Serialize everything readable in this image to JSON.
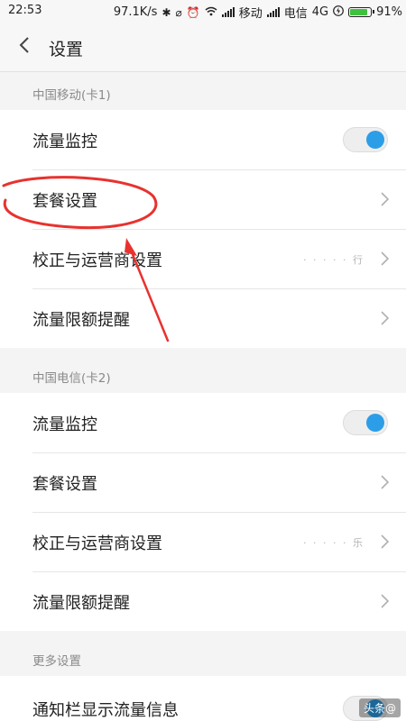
{
  "status_bar": {
    "time": "22:53",
    "net_speed": "97.1K/s",
    "carrier1": "移动",
    "carrier2": "电信",
    "network_type": "4G",
    "battery_pct": "91%",
    "battery_level": 0.91
  },
  "header": {
    "title": "设置"
  },
  "sections": [
    {
      "label": "中国移动(卡1)",
      "rows": [
        {
          "label": "流量监控",
          "type": "toggle",
          "on": true
        },
        {
          "label": "套餐设置",
          "type": "nav"
        },
        {
          "label": "校正与运营商设置",
          "type": "nav",
          "value": "· · · · · 行"
        },
        {
          "label": "流量限额提醒",
          "type": "nav"
        }
      ]
    },
    {
      "label": "中国电信(卡2)",
      "rows": [
        {
          "label": "流量监控",
          "type": "toggle",
          "on": true
        },
        {
          "label": "套餐设置",
          "type": "nav"
        },
        {
          "label": "校正与运营商设置",
          "type": "nav",
          "value": "· · · · · 乐"
        },
        {
          "label": "流量限额提醒",
          "type": "nav"
        }
      ]
    },
    {
      "label": "更多设置",
      "rows": [
        {
          "label": "通知栏显示流量信息",
          "type": "toggle",
          "on": true
        }
      ]
    }
  ],
  "watermark": "头条@",
  "colors": {
    "accent": "#2c9ee8",
    "annotation": "#e8322e"
  }
}
